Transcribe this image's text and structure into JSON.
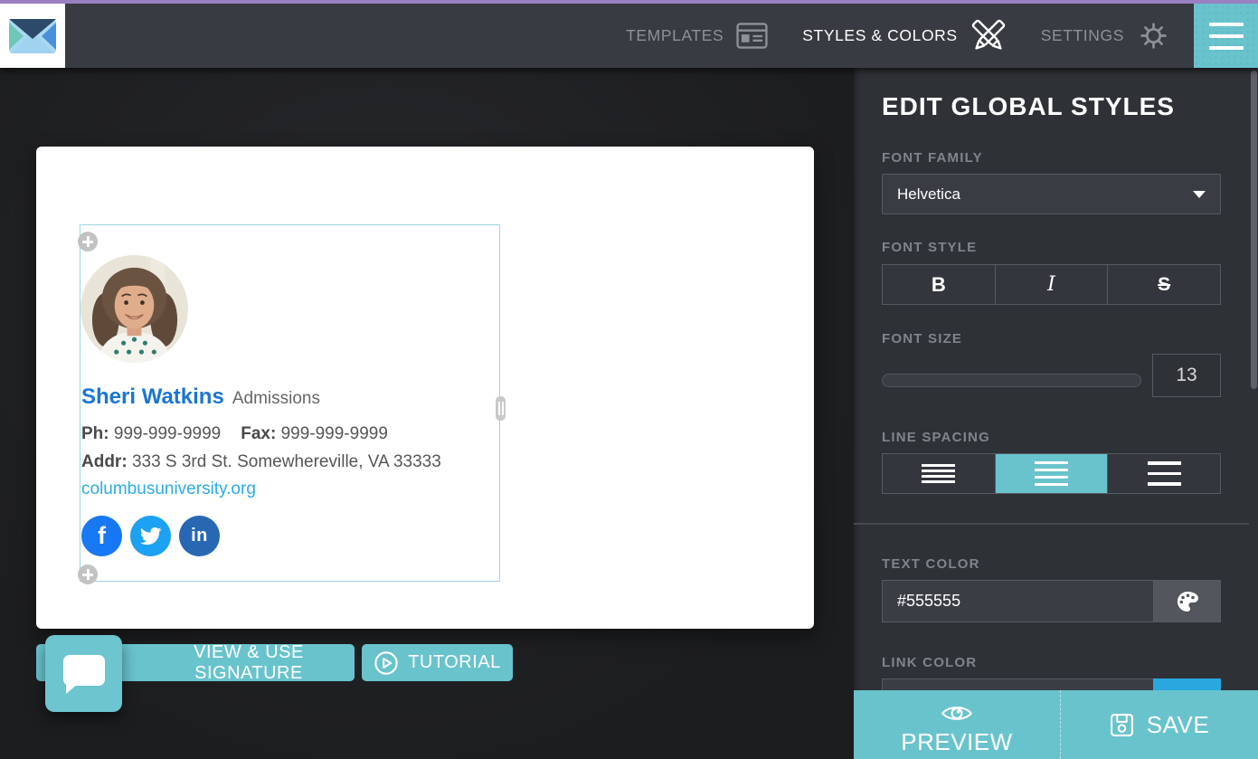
{
  "colors": {
    "accent_teal": "#69c3cd",
    "top_strip_purple": "#9a7fc1",
    "nav_bg": "#383b41",
    "sidebar_bg": "#2e3136",
    "name_blue": "#1a76d2",
    "link_blue": "#2bace2",
    "facebook_blue": "#1877f2",
    "twitter_blue": "#1da1f2",
    "linkedin_blue": "#2867b2",
    "link_swatch_blue": "#29a8e0"
  },
  "nav": {
    "items": [
      {
        "label": "TEMPLATES"
      },
      {
        "label": "STYLES & COLORS"
      },
      {
        "label": "SETTINGS"
      }
    ]
  },
  "signature": {
    "name": "Sheri Watkins",
    "job_title": "Admissions",
    "phone_label": "Ph:",
    "phone": "999-999-9999",
    "fax_label": "Fax:",
    "fax": "999-999-9999",
    "address_label": "Addr:",
    "address": "333 S 3rd St. Somewhereville, VA 33333",
    "website": "columbusuniversity.org",
    "facebook_glyph": "f",
    "linkedin_glyph": "in"
  },
  "actions": {
    "view_use_label": "VIEW & USE SIGNATURE",
    "tutorial_label": "TUTORIAL"
  },
  "panel": {
    "title": "EDIT GLOBAL STYLES",
    "font_family": {
      "label": "FONT FAMILY",
      "value": "Helvetica"
    },
    "font_style": {
      "label": "FONT STYLE",
      "bold": "B",
      "italic": "I",
      "strike": "S"
    },
    "font_size": {
      "label": "FONT SIZE",
      "value": "13"
    },
    "line_spacing": {
      "label": "LINE SPACING"
    },
    "text_color": {
      "label": "TEXT COLOR",
      "value": "#555555"
    },
    "link_color": {
      "label": "LINK COLOR"
    },
    "preview_label": "PREVIEW",
    "save_label": "SAVE"
  }
}
